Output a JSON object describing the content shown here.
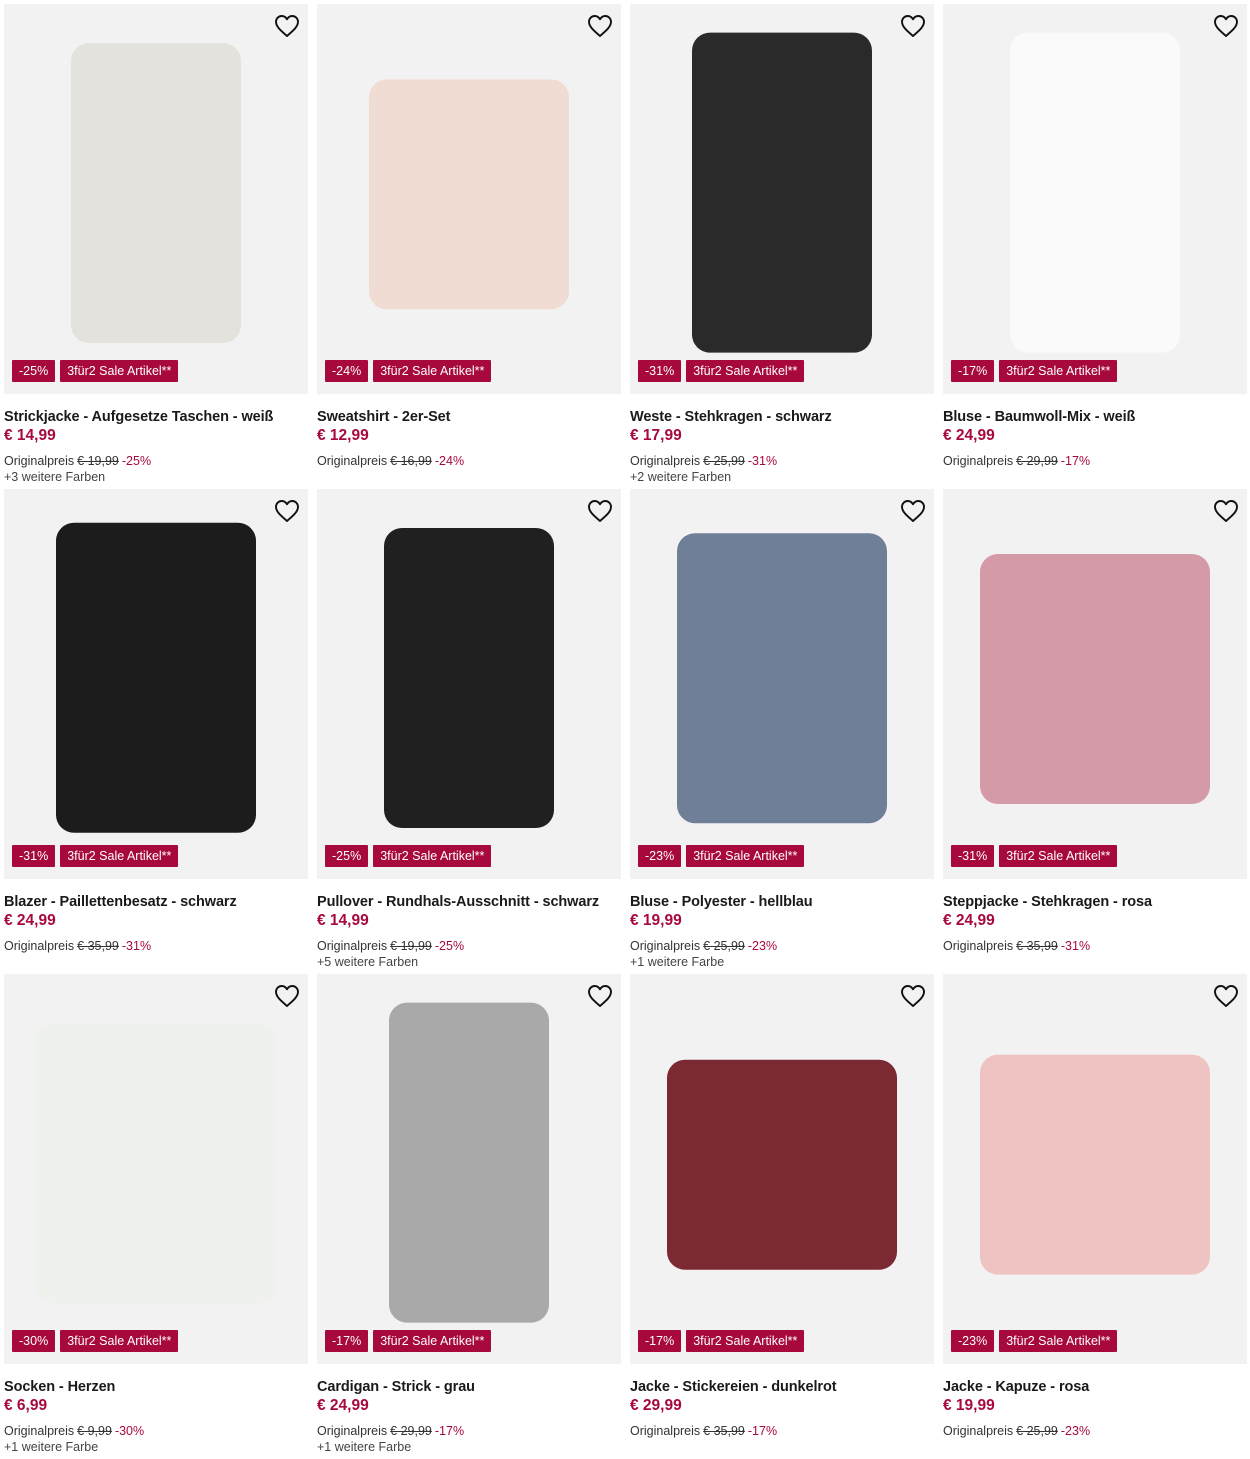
{
  "colors": {
    "accent": "#a7093c",
    "image_bg": "#f2f2f2"
  },
  "icons": {
    "wishlist": "heart-outline-icon"
  },
  "products": [
    {
      "title": "Strickjacke - Aufgesetze Taschen - weiß",
      "price": "€ 14,99",
      "orig_label": "Originalpreis",
      "orig_price": "€ 19,99",
      "discount": "-25%",
      "promo": "3für2 Sale Artikel**",
      "colors": "+3 weitere Farben",
      "swatch": "#e4e2dc"
    },
    {
      "title": "Sweatshirt - 2er-Set",
      "price": "€ 12,99",
      "orig_label": "Originalpreis",
      "orig_price": "€ 16,99",
      "discount": "-24%",
      "promo": "3für2 Sale Artikel**",
      "colors": "",
      "swatch": "#f1dcd3"
    },
    {
      "title": "Weste - Stehkragen - schwarz",
      "price": "€ 17,99",
      "orig_label": "Originalpreis",
      "orig_price": "€ 25,99",
      "discount": "-31%",
      "promo": "3für2 Sale Artikel**",
      "colors": "+2 weitere Farben",
      "swatch": "#2a2a2a"
    },
    {
      "title": "Bluse - Baumwoll-Mix - weiß",
      "price": "€ 24,99",
      "orig_label": "Originalpreis",
      "orig_price": "€ 29,99",
      "discount": "-17%",
      "promo": "3für2 Sale Artikel**",
      "colors": "",
      "swatch": "#fafafa"
    },
    {
      "title": "Blazer - Paillettenbesatz - schwarz",
      "price": "€ 24,99",
      "orig_label": "Originalpreis",
      "orig_price": "€ 35,99",
      "discount": "-31%",
      "promo": "3für2 Sale Artikel**",
      "colors": "",
      "swatch": "#1c1c1c"
    },
    {
      "title": "Pullover - Rundhals-Ausschnitt - schwarz",
      "price": "€ 14,99",
      "orig_label": "Originalpreis",
      "orig_price": "€ 19,99",
      "discount": "-25%",
      "promo": "3für2 Sale Artikel**",
      "colors": "+5 weitere Farben",
      "swatch": "#202020"
    },
    {
      "title": "Bluse - Polyester - hellblau",
      "price": "€ 19,99",
      "orig_label": "Originalpreis",
      "orig_price": "€ 25,99",
      "discount": "-23%",
      "promo": "3für2 Sale Artikel**",
      "colors": "+1 weitere Farbe",
      "swatch": "#6f7f98"
    },
    {
      "title": "Steppjacke - Stehkragen - rosa",
      "price": "€ 24,99",
      "orig_label": "Originalpreis",
      "orig_price": "€ 35,99",
      "discount": "-31%",
      "promo": "3für2 Sale Artikel**",
      "colors": "",
      "swatch": "#d49aa8"
    },
    {
      "title": "Socken - Herzen",
      "price": "€ 6,99",
      "orig_label": "Originalpreis",
      "orig_price": "€ 9,99",
      "discount": "-30%",
      "promo": "3für2 Sale Artikel**",
      "colors": "+1 weitere Farbe",
      "swatch": "#eff2ec"
    },
    {
      "title": "Cardigan - Strick - grau",
      "price": "€ 24,99",
      "orig_label": "Originalpreis",
      "orig_price": "€ 29,99",
      "discount": "-17%",
      "promo": "3für2 Sale Artikel**",
      "colors": "+1 weitere Farbe",
      "swatch": "#a9a9a9"
    },
    {
      "title": "Jacke - Stickereien - dunkelrot",
      "price": "€ 29,99",
      "orig_label": "Originalpreis",
      "orig_price": "€ 35,99",
      "discount": "-17%",
      "promo": "3für2 Sale Artikel**",
      "colors": "",
      "swatch": "#7b2a33"
    },
    {
      "title": "Jacke - Kapuze - rosa",
      "price": "€ 19,99",
      "orig_label": "Originalpreis",
      "orig_price": "€ 25,99",
      "discount": "-23%",
      "promo": "3für2 Sale Artikel**",
      "colors": "",
      "swatch": "#efc3c2"
    }
  ]
}
